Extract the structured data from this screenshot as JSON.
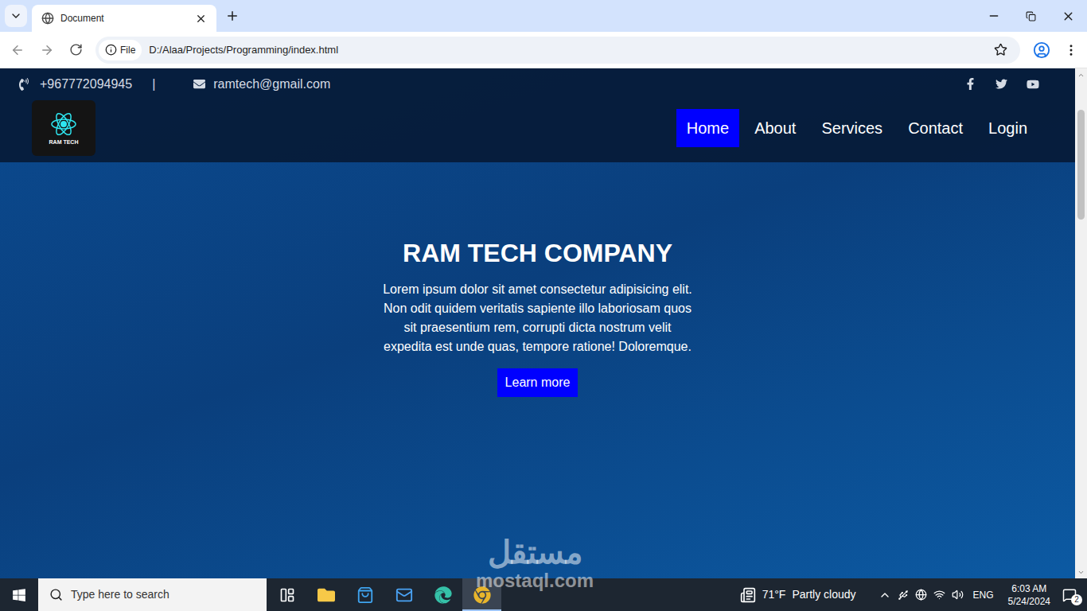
{
  "browser": {
    "tab": {
      "title": "Document",
      "selected": true
    },
    "address": {
      "scheme": "File",
      "url": "D:/Alaa/Projects/Programming/index.html"
    }
  },
  "page": {
    "contact": {
      "phone": "+967772094945",
      "separator": "|",
      "email": "ramtech@gmail.com"
    },
    "logo": {
      "title": "RAM TECH"
    },
    "nav": [
      {
        "label": "Home",
        "selected": true
      },
      {
        "label": "About",
        "selected": false
      },
      {
        "label": "Services",
        "selected": false
      },
      {
        "label": "Contact",
        "selected": false
      },
      {
        "label": "Login",
        "selected": false
      }
    ],
    "hero": {
      "title": "RAM TECH COMPANY",
      "text": "Lorem ipsum dolor sit amet consectetur adipisicing elit. Non odit quidem veritatis sapiente illo laboriosam quos sit praesentium rem, corrupti dicta nostrum velit expedita est unde quas, tempore ratione! Doloremque.",
      "button": "Learn more"
    }
  },
  "watermark": {
    "arabic": "مستقل",
    "latin": "mostaql.com"
  },
  "taskbar": {
    "search_placeholder": "Type here to search",
    "apps": [
      {
        "kind": "taskview",
        "selected": false
      },
      {
        "kind": "explorer",
        "selected": false
      },
      {
        "kind": "store",
        "selected": false
      },
      {
        "kind": "mail",
        "selected": false
      },
      {
        "kind": "edge",
        "selected": false
      },
      {
        "kind": "chrome",
        "selected": true
      }
    ],
    "weather": {
      "temp": "71°F",
      "condition": "Partly cloudy"
    },
    "language": "ENG",
    "time": "6:03 AM",
    "date": "5/24/2024",
    "notifications": "2"
  }
}
